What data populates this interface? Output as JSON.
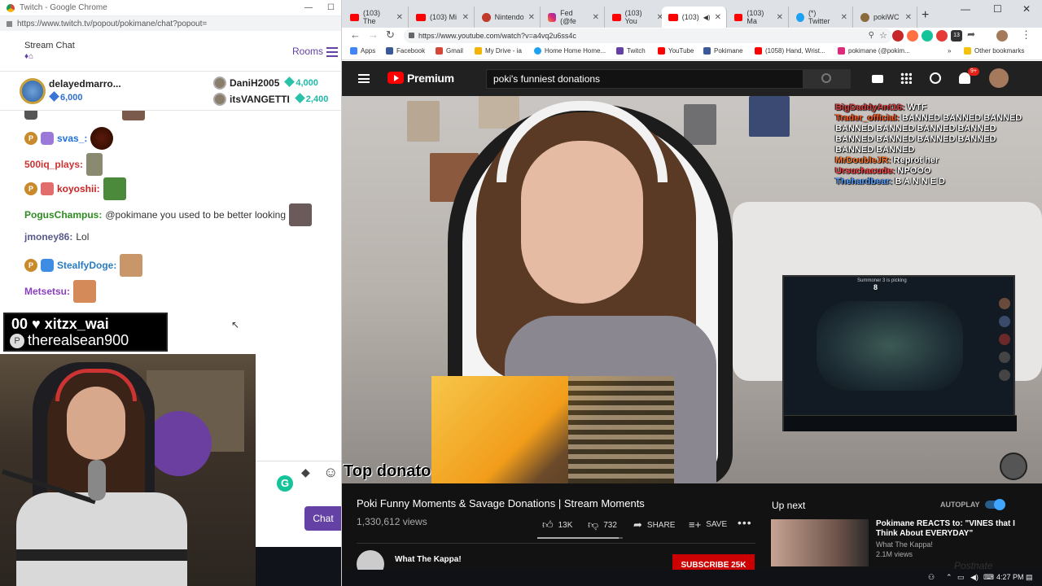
{
  "twitch_window": {
    "title": "Twitch - Google Chrome",
    "url": "https://www.twitch.tv/popout/pokimane/chat?popout=",
    "header_title": "Stream Chat",
    "rooms_label": "Rooms"
  },
  "leaderboard": {
    "first": {
      "name": "delayedmarro...",
      "bits": "6,000"
    },
    "second": {
      "name": "DaniH2005",
      "bits": "4,000"
    },
    "third": {
      "name": "itsVANGETTI",
      "bits": "2,400"
    }
  },
  "chat": {
    "messages": [
      {
        "user": "svas_:",
        "color": "#1e6fd6",
        "text": ""
      },
      {
        "user": "500iq_plays:",
        "color": "#cc3333",
        "text": ""
      },
      {
        "user": "koyoshii:",
        "color": "#cc2222",
        "text": ""
      },
      {
        "user": "PogusChampus:",
        "color": "#2e8b22",
        "text": "@pokimane you used to be better looking"
      },
      {
        "user": "jmoney86:",
        "color": "#5a5a8a",
        "text": "Lol"
      },
      {
        "user": "StealfyDoge:",
        "color": "#2a7bbf",
        "text": ""
      },
      {
        "user": "Metsetsu:",
        "color": "#8a3fbf",
        "text": ""
      }
    ],
    "send_label": "Chat"
  },
  "alert": {
    "line1": "00 ♥      xitzx_wai",
    "line2": "therealsean900"
  },
  "chrome": {
    "tabs": [
      {
        "label": "(103) The",
        "icon": "youtube-icon"
      },
      {
        "label": "(103) Mi",
        "icon": "youtube-icon"
      },
      {
        "label": "Nintendo",
        "icon": "mario-icon"
      },
      {
        "label": "Fed (@fe",
        "icon": "instagram-icon"
      },
      {
        "label": "(103) You",
        "icon": "youtube-icon"
      },
      {
        "label": "(103)",
        "icon": "youtube-icon"
      },
      {
        "label": "(103) Ma",
        "icon": "youtube-icon"
      },
      {
        "label": "(*) Twitter",
        "icon": "twitter-icon"
      },
      {
        "label": "pokiWC",
        "icon": "poki-icon"
      }
    ],
    "url": "https://www.youtube.com/watch?v=a4vq2u6ss4c",
    "ext_badge": "13",
    "bookmarks": [
      {
        "label": "Apps",
        "color": "#4285f4"
      },
      {
        "label": "Facebook",
        "color": "#3b5998"
      },
      {
        "label": "Gmail",
        "color": "#d44638"
      },
      {
        "label": "My Drive - ia",
        "color": "#f4b400"
      },
      {
        "label": "Home Home Home...",
        "color": "#1da1f2"
      },
      {
        "label": "Twitch",
        "color": "#6441a4"
      },
      {
        "label": "YouTube",
        "color": "#ff0000"
      },
      {
        "label": "Pokimane",
        "color": "#3b5998"
      },
      {
        "label": "(1058) Hand, Wrist...",
        "color": "#ff0000"
      },
      {
        "label": "pokimane (@pokim...",
        "color": "#dd2a7b"
      }
    ],
    "other_bookmarks": "Other bookmarks"
  },
  "youtube": {
    "brand": "Premium",
    "search_value": "poki's funniest donations",
    "notifications": "9+",
    "video": {
      "chat_overlay": [
        {
          "user": "BigDaddyAnt16:",
          "text": "WTF",
          "cls": "u1"
        },
        {
          "user": "Trader_official:",
          "text": "BANNED BANNED BANNED BANNED BANNED BANNED BANNED BANNED BANNED BANNED BANNED BANNED BANNED",
          "cls": "u2"
        },
        {
          "user": "MrDoubleJR:",
          "text": "Reprot her",
          "cls": "u3"
        },
        {
          "user": "Ursuchacude:",
          "text": "NPOOO",
          "cls": "u4"
        },
        {
          "user": "Thehardbear:",
          "text": "B A N N E D",
          "cls": "u5"
        }
      ],
      "game_pick_text": "Summoner 3 is picking",
      "game_score_left": "8",
      "game_score_right": "8",
      "top_donator": "Top donato"
    },
    "title": "Poki Funny Moments & Savage Donations | Stream Moments",
    "views": "1,330,612 views",
    "likes": "13K",
    "dislikes": "732",
    "like_ratio": 0.95,
    "share_label": "SHARE",
    "save_label": "SAVE",
    "channel": "What The Kappa!",
    "subscribe_label": "SUBSCRIBE 25K",
    "up_next_label": "Up next",
    "autoplay_label": "AUTOPLAY",
    "rec": {
      "title": "Pokimane REACTS to: \"VINES that I Think About EVERYDAY\"",
      "channel": "What The Kappa!",
      "views": "2.1M views"
    },
    "watermark": "Postnate"
  },
  "taskbar": {
    "time": "4:27 PM"
  }
}
